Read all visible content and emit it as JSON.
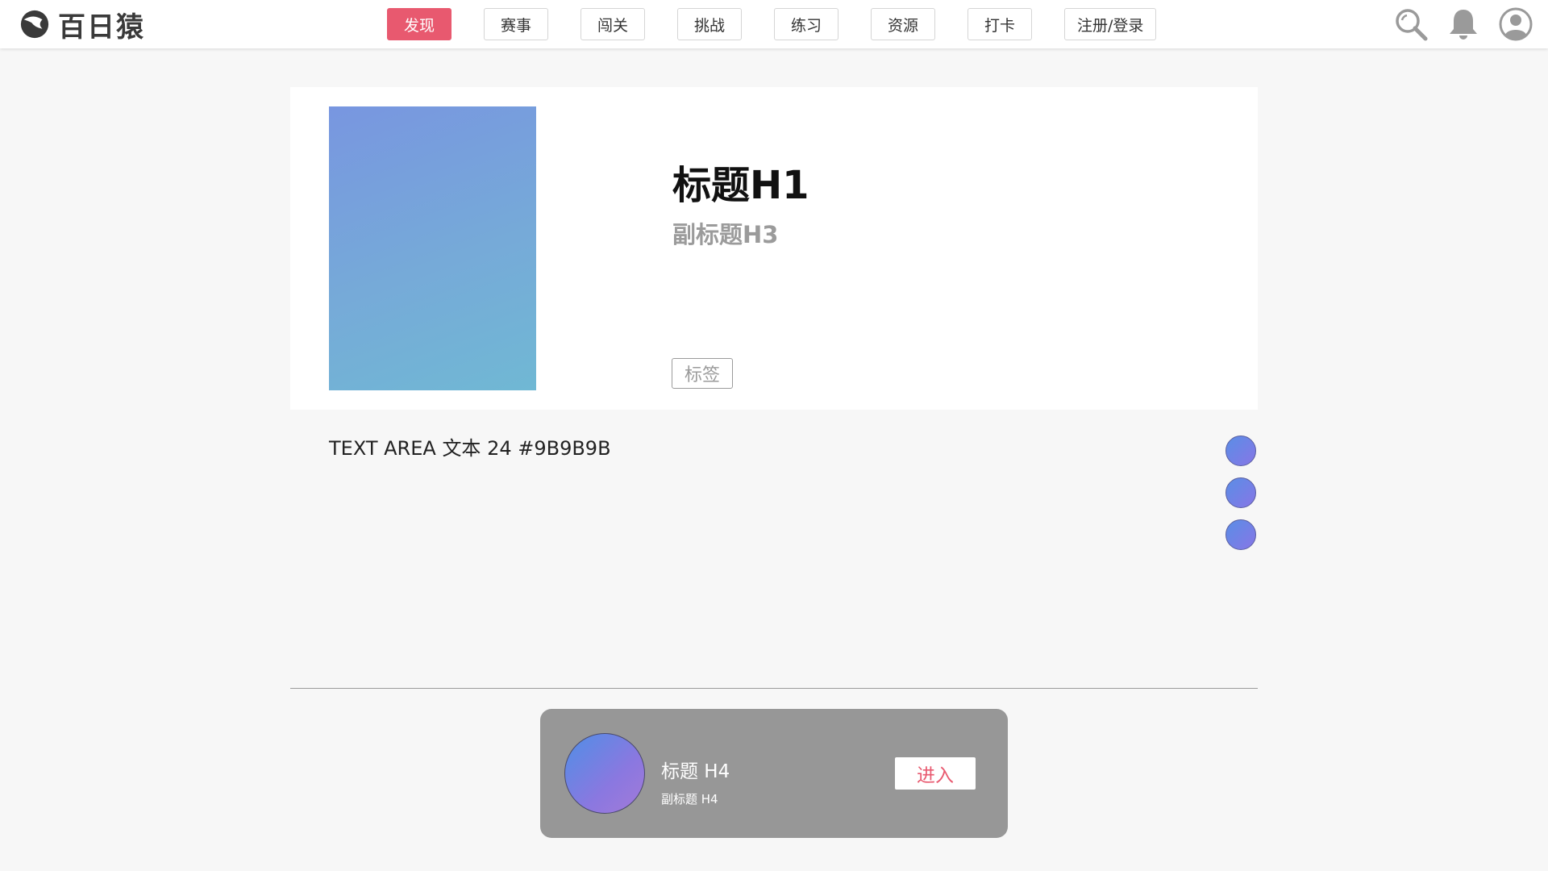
{
  "app": {
    "logo_text": "百日猿"
  },
  "nav": {
    "items": [
      {
        "label": "发现",
        "active": true
      },
      {
        "label": "赛事"
      },
      {
        "label": "闯关"
      },
      {
        "label": "挑战"
      },
      {
        "label": "练习"
      },
      {
        "label": "资源"
      },
      {
        "label": "打卡"
      },
      {
        "label": "注册/登录"
      }
    ]
  },
  "header_icons": [
    "search-icon",
    "bell-icon",
    "user-icon"
  ],
  "card": {
    "title": "标题H1",
    "subtitle": "副标题H3",
    "tag": "标签"
  },
  "text_area": "TEXT AREA 文本 24 #9B9B9B",
  "bottom_card": {
    "title": "标题 H4",
    "subtitle": "副标题 H4",
    "button": "进入"
  },
  "colors": {
    "accent": "#e8596f",
    "muted_text": "#9B9B9B",
    "page_bg": "#f7f7f7",
    "bottom_card_bg": "#979797"
  }
}
